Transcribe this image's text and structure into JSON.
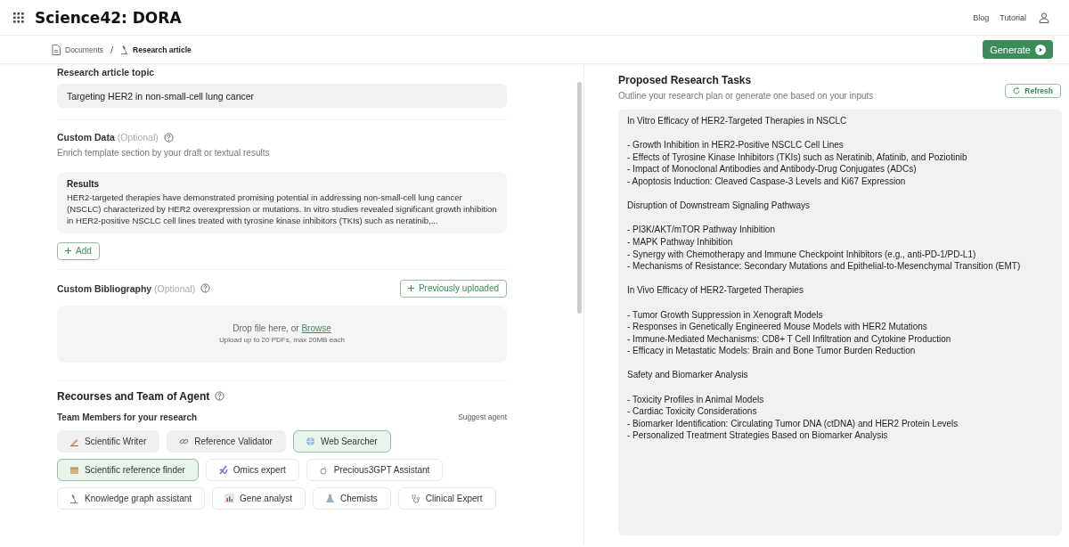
{
  "app": {
    "title": "Science42: DORA",
    "nav": [
      "Blog",
      "Tutorial"
    ]
  },
  "breadcrumb": {
    "separator": "/",
    "items": [
      "Documents",
      "Research article"
    ]
  },
  "generate_button": "Generate",
  "topic": {
    "label": "Research article topic",
    "value": "Targeting HER2 in non-small-cell lung cancer"
  },
  "custom_data": {
    "title": "Custom Data",
    "optional": "(Optional)",
    "description": "Enrich template section by your draft or textual results",
    "card": {
      "title": "Results",
      "text": "HER2-targeted therapies have demonstrated promising potential in addressing non-small-cell lung cancer (NSCLC) characterized by HER2 overexpression or mutations. In vitro studies revealed significant growth inhibition in HER2-positive NSCLC cell lines treated with tyrosine kinase inhibitors (TKIs) such as neratinib,..."
    },
    "add_button": "Add"
  },
  "bibliography": {
    "title": "Custom Bibliography",
    "optional": "(Optional)",
    "previous_button": "Previously uploaded",
    "drop_text": "Drop file here, or",
    "browse_link": "Browse",
    "hint": "Upload up to 20 PDFs, max 20MB each"
  },
  "team": {
    "title": "Recourses and Team of Agent",
    "subtitle": "Team Members for your research",
    "suggest_link": "Suggest agent",
    "rows": [
      [
        {
          "label": "Scientific Writer",
          "kind": "fixed",
          "selected": false
        },
        {
          "label": "Reference Validator",
          "kind": "fixed",
          "selected": false
        },
        {
          "label": "Web Searcher",
          "kind": "optional",
          "selected": true
        }
      ],
      [
        {
          "label": "Scientific reference finder",
          "kind": "optional",
          "selected": true
        },
        {
          "label": "Omics expert",
          "kind": "optional",
          "selected": false
        },
        {
          "label": "Precious3GPT Assistant",
          "kind": "optional",
          "selected": false
        }
      ],
      [
        {
          "label": "Knowledge graph assistant",
          "kind": "optional",
          "selected": false
        },
        {
          "label": "Gene analyst",
          "kind": "optional",
          "selected": false
        },
        {
          "label": "Chemists",
          "kind": "optional",
          "selected": false
        },
        {
          "label": "Clinical Expert",
          "kind": "optional",
          "selected": false
        }
      ]
    ]
  },
  "tasks": {
    "title": "Proposed Research Tasks",
    "subtitle": "Outline your research plan or generate one based on your inputs",
    "refresh_button": "Refresh",
    "sections": [
      {
        "title": "In Vitro Efficacy of HER2-Targeted Therapies in NSCLC",
        "items": [
          "- Growth Inhibition in HER2-Positive NSCLC Cell Lines",
          "- Effects of Tyrosine Kinase Inhibitors (TKIs) such as Neratinib, Afatinib, and Poziotinib",
          "- Impact of Monoclonal Antibodies and Antibody-Drug Conjugates (ADCs)",
          "- Apoptosis Induction: Cleaved Caspase-3 Levels and Ki67 Expression"
        ]
      },
      {
        "title": "Disruption of Downstream Signaling Pathways",
        "items": [
          "- PI3K/AKT/mTOR Pathway Inhibition",
          "- MAPK Pathway Inhibition",
          "- Synergy with Chemotherapy and Immune Checkpoint Inhibitors (e.g., anti-PD-1/PD-L1)",
          "- Mechanisms of Resistance: Secondary Mutations and Epithelial-to-Mesenchymal Transition (EMT)"
        ]
      },
      {
        "title": "In Vivo Efficacy of HER2-Targeted Therapies",
        "items": [
          "- Tumor Growth Suppression in Xenograft Models",
          "- Responses in Genetically Engineered Mouse Models with HER2 Mutations",
          "- Immune-Mediated Mechanisms: CD8+ T Cell Infiltration and Cytokine Production",
          "- Efficacy in Metastatic Models: Brain and Bone Tumor Burden Reduction"
        ]
      },
      {
        "title": "Safety and Biomarker Analysis",
        "items": [
          "- Toxicity Profiles in Animal Models",
          "- Cardiac Toxicity Considerations",
          "- Biomarker Identification: Circulating Tumor DNA (ctDNA) and HER2 Protein Levels",
          "- Personalized Treatment Strategies Based on Biomarker Analysis"
        ]
      }
    ]
  }
}
